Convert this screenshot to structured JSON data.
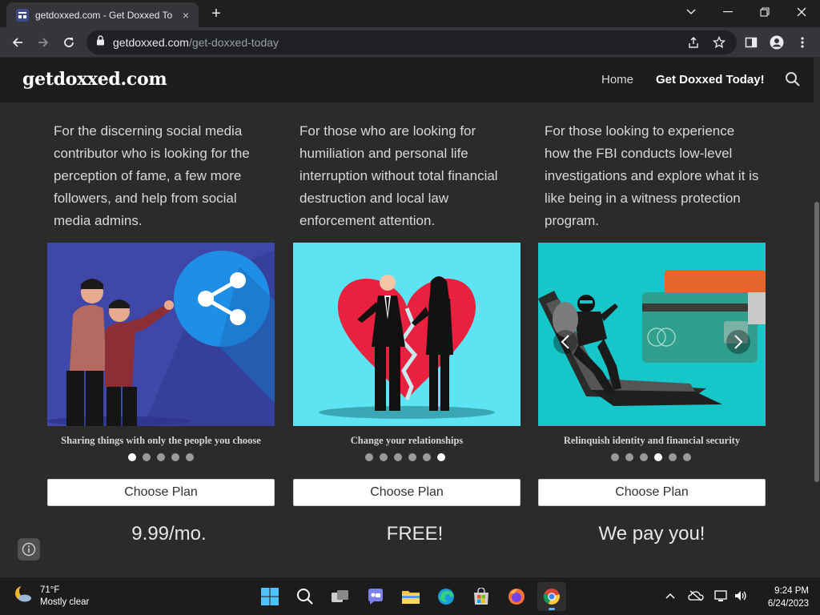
{
  "browser": {
    "tab": {
      "title": "getdoxxed.com - Get Doxxed To",
      "close_icon": "×"
    },
    "new_tab_icon": "+",
    "window_controls": {
      "dropdown": "⌄",
      "minimize": "—",
      "restore": "❐",
      "close": "✕"
    },
    "url": {
      "host": "getdoxxed.com",
      "path": "/get-doxxed-today"
    }
  },
  "site": {
    "brand": "getdoxxed.com",
    "nav": {
      "home": "Home",
      "active": "Get Doxxed Today!"
    }
  },
  "plans": [
    {
      "description": "For the discerning social media contributor who is looking for the perception of fame, a few more followers, and help from social media admins.",
      "caption": "Sharing things with only the people you choose",
      "dots_total": 5,
      "dots_active": 0,
      "button": "Choose Plan",
      "price": "9.99/mo."
    },
    {
      "description": "For those who are looking for humiliation and personal life interruption without total financial destruction and local law enforcement attention.",
      "caption": "Change your relationships",
      "dots_total": 6,
      "dots_active": 5,
      "button": "Choose Plan",
      "price": "FREE!"
    },
    {
      "description": "For those  looking to experience how the FBI conducts low-level investigations and explore what it is like being in a witness protection program.",
      "caption": "Relinquish identity and financial security",
      "dots_total": 6,
      "dots_active": 3,
      "button": "Choose Plan",
      "price": "We pay you!"
    }
  ],
  "taskbar": {
    "weather": {
      "temp": "71°F",
      "condition": "Mostly clear"
    },
    "clock": {
      "time": "9:24 PM",
      "date": "6/24/2023"
    }
  },
  "colors": {
    "slide1_bg": "#3f48a8",
    "slide2_bg": "#5ee3f2",
    "slide3_bg": "#16c6c9",
    "heart": "#e8213f"
  }
}
